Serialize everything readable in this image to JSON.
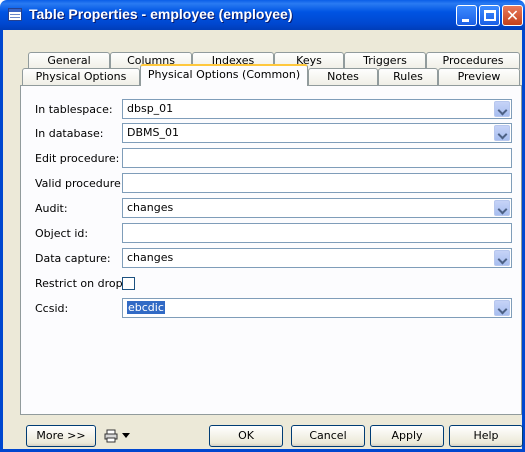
{
  "window": {
    "title": "Table Properties - employee (employee)"
  },
  "tabs": {
    "row1": [
      "General",
      "Columns",
      "Indexes",
      "Keys",
      "Triggers",
      "Procedures"
    ],
    "row2": [
      "Physical Options",
      "Physical Options (Common)",
      "Notes",
      "Rules",
      "Preview"
    ],
    "active": "Physical Options (Common)"
  },
  "form": {
    "in_tablespace": {
      "label": "In tablespace:",
      "value": "dbsp_01"
    },
    "in_database": {
      "label": "In database:",
      "value": "DBMS_01"
    },
    "edit_procedure": {
      "label": "Edit procedure:",
      "value": ""
    },
    "valid_procedure": {
      "label": "Valid procedure:",
      "value": ""
    },
    "audit": {
      "label": "Audit:",
      "value": "changes"
    },
    "object_id": {
      "label": "Object id:",
      "value": ""
    },
    "data_capture": {
      "label": "Data capture:",
      "value": "changes"
    },
    "restrict_on_drop": {
      "label": "Restrict on drop:",
      "checked": false
    },
    "ccsid": {
      "label": "Ccsid:",
      "value": "ebcdic"
    }
  },
  "buttons": {
    "more": "More >>",
    "ok": "OK",
    "cancel": "Cancel",
    "apply": "Apply",
    "help": "Help"
  },
  "icons": {
    "window": "table-icon",
    "print": "print-icon"
  },
  "colors": {
    "titlebar": "#0054e3",
    "dialog_bg": "#ece9d8",
    "selection": "#316ac5",
    "active_tab_accent": "#ffc83c"
  }
}
